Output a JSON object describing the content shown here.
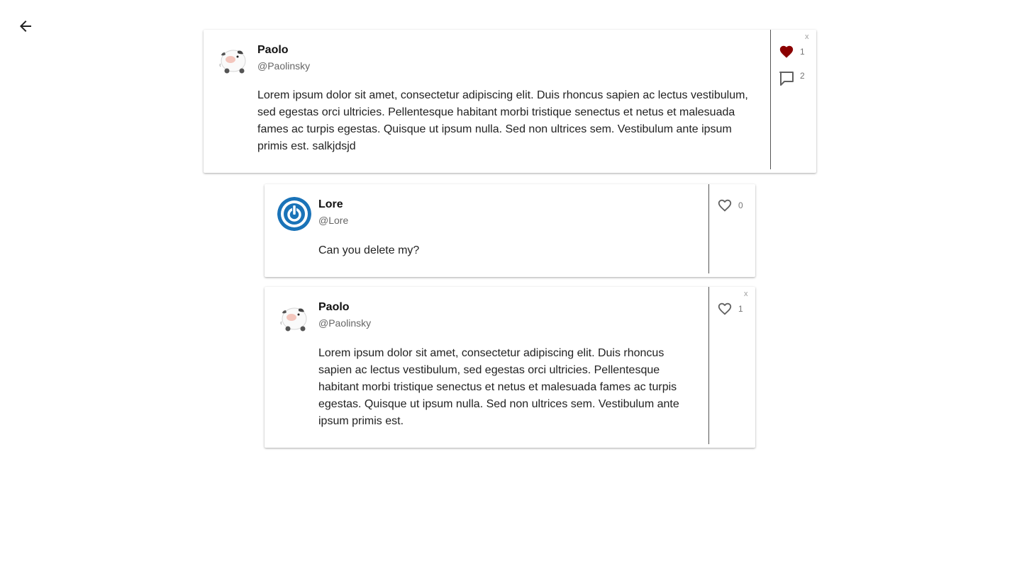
{
  "nav": {
    "back_label": "Back"
  },
  "main_post": {
    "author_name": "Paolo",
    "author_handle": "@Paolinsky",
    "text": "Lorem ipsum dolor sit amet, consectetur adipiscing elit. Duis rhoncus sapien ac lectus vestibulum, sed egestas orci ultricies. Pellentesque habitant morbi tristique senectus et netus et malesuada fames ac turpis egestas. Quisque ut ipsum nulla. Sed non ultrices sem. Vestibulum ante ipsum primis est. salkjdsjd",
    "likes": "1",
    "liked": true,
    "comments": "2",
    "delete_label": "x"
  },
  "replies": [
    {
      "author_name": "Lore",
      "author_handle": "@Lore",
      "text": "Can you delete my?",
      "likes": "0",
      "liked": false
    },
    {
      "author_name": "Paolo",
      "author_handle": "@Paolinsky",
      "text": "Lorem ipsum dolor sit amet, consectetur adipiscing elit. Duis rhoncus sapien ac lectus vestibulum, sed egestas orci ultricies. Pellentesque habitant morbi tristique senectus et netus et malesuada fames ac turpis egestas. Quisque ut ipsum nulla. Sed non ultrices sem. Vestibulum ante ipsum primis est.",
      "likes": "1",
      "liked": false,
      "delete_label": "x"
    }
  ],
  "colors": {
    "liked_heart": "#8b0000",
    "icon_gray": "#616161",
    "power_avatar": "#1a73b8"
  },
  "icons": {
    "back": "arrow-left-icon",
    "like": "heart-icon",
    "comment": "comment-icon",
    "avatar_cow": "cow-avatar-icon",
    "avatar_power": "power-avatar-icon"
  }
}
